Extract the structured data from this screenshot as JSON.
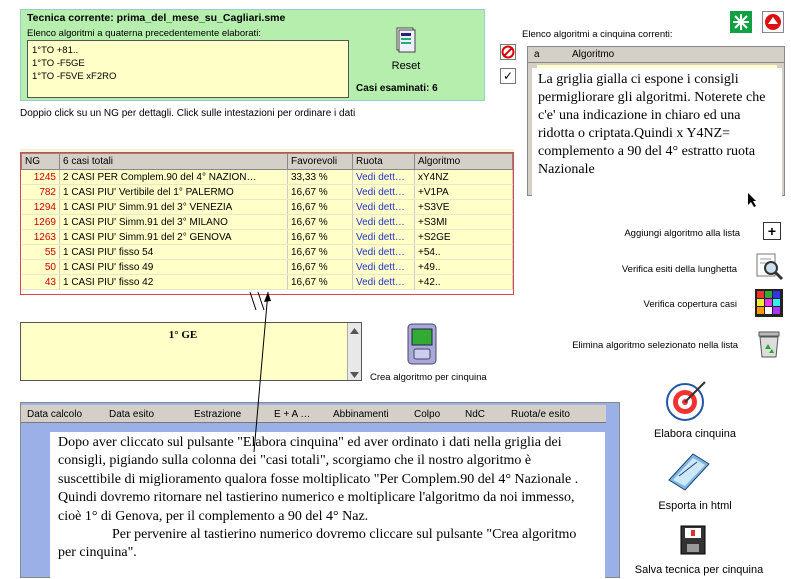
{
  "top_panel": {
    "title": "Tecnica corrente: prima_del_mese_su_Cagliari.sme",
    "list_caption": "Elenco algoritmi a quaterna precedentemente elaborati:",
    "list_items": [
      "1°TO +81..",
      "1°TO -F5GE",
      "1°TO -F5VE xF2RO"
    ],
    "reset_label": "Reset",
    "casi_esaminati": "Casi esaminati: 6"
  },
  "hint": "Doppio click su un NG per dettagli. Click sulle intestazioni per ordinare i dati",
  "advice_grid": {
    "headers": [
      "NG",
      "6 casi totali",
      "Favorevoli",
      "Ruota",
      "Algoritmo"
    ],
    "rows": [
      [
        "1245",
        "2 CASI PER Complem.90 del 4° NAZION…",
        "33,33 %",
        "Vedi dett…",
        "xY4NZ"
      ],
      [
        "782",
        "1 CASI PIU' Vertibile del 1° PALERMO",
        "16,67 %",
        "Vedi dett…",
        "+V1PA"
      ],
      [
        "1294",
        "1 CASI PIU' Simm.91 del 3° VENEZIA",
        "16,67 %",
        "Vedi dett…",
        "+S3VE"
      ],
      [
        "1269",
        "1 CASI PIU' Simm.91 del 3° MILANO",
        "16,67 %",
        "Vedi dett…",
        "+S3MI"
      ],
      [
        "1263",
        "1 CASI PIU' Simm.91 del 2° GENOVA",
        "16,67 %",
        "Vedi dett…",
        "+S2GE"
      ],
      [
        "55",
        "1 CASI PIU' fisso 54",
        "16,67 %",
        "Vedi dett…",
        "+54.."
      ],
      [
        "50",
        "1 CASI PIU' fisso 49",
        "16,67 %",
        "Vedi dett…",
        "+49.."
      ],
      [
        "43",
        "1 CASI PIU' fisso 42",
        "16,67 %",
        "Vedi dett…",
        "+42.."
      ]
    ]
  },
  "algo_grid": {
    "caption": "Elenco algoritmi a cinquina correnti:",
    "col_a": "a",
    "col_algoritmo": "Algoritmo"
  },
  "actions": {
    "aggiungi": "Aggiungi algoritmo alla lista",
    "verifica_esiti": "Verifica esiti della lunghetta",
    "verifica_copertura": "Verifica copertura casi",
    "elimina": "Elimina algoritmo selezionato nella lista"
  },
  "ng_panel": {
    "value": "1° GE"
  },
  "crea_label": "Crea algoritmo per cinquina",
  "result_grid": {
    "headers": [
      "Data calcolo",
      "Data esito",
      "Estrazione",
      "E + A …",
      "Abbinamenti",
      "Colpo",
      "NdC",
      "Ruota/e esito"
    ]
  },
  "big_actions": {
    "elabora": "Elabora cinquina",
    "esporta": "Esporta in html",
    "salva": "Salva tecnica per cinquina"
  },
  "notes": {
    "right": "La griglia gialla ci espone i consigli permigliorare gli algoritmi. Noterete che c'e' una indicazione in chiaro ed una ridotta o criptata.Quindi x Y4NZ= complemento a 90 del 4° estratto ruota Nazionale",
    "bottom_1": "Dopo aver cliccato sul pulsante \"Elabora cinquina\" ed aver ordinato i dati nella griglia dei consigli, pigiando sulla colonna dei \"casi totali\", scorgiamo che il nostro algoritmo è suscettibile di miglioramento qualora fosse moltiplicato \"Per Complem.90 del 4° Nazionale . Quindi dovremo ritornare nel tastierino numerico e moltiplicare l'algoritmo da noi immesso, cioè 1° di Genova, per il complemento a 90 del 4° Naz.",
    "bottom_2": "Per pervenire al tastierino numerico dovremo cliccare sul pulsante \"Crea algoritmo per cinquina\"."
  },
  "colors": {
    "panel_green": "#b6eeae",
    "grid_yellow": "#ffffc8",
    "result_blue": "#9bb0e6",
    "ng_red": "#cc0000",
    "link_blue": "#2233cc"
  }
}
